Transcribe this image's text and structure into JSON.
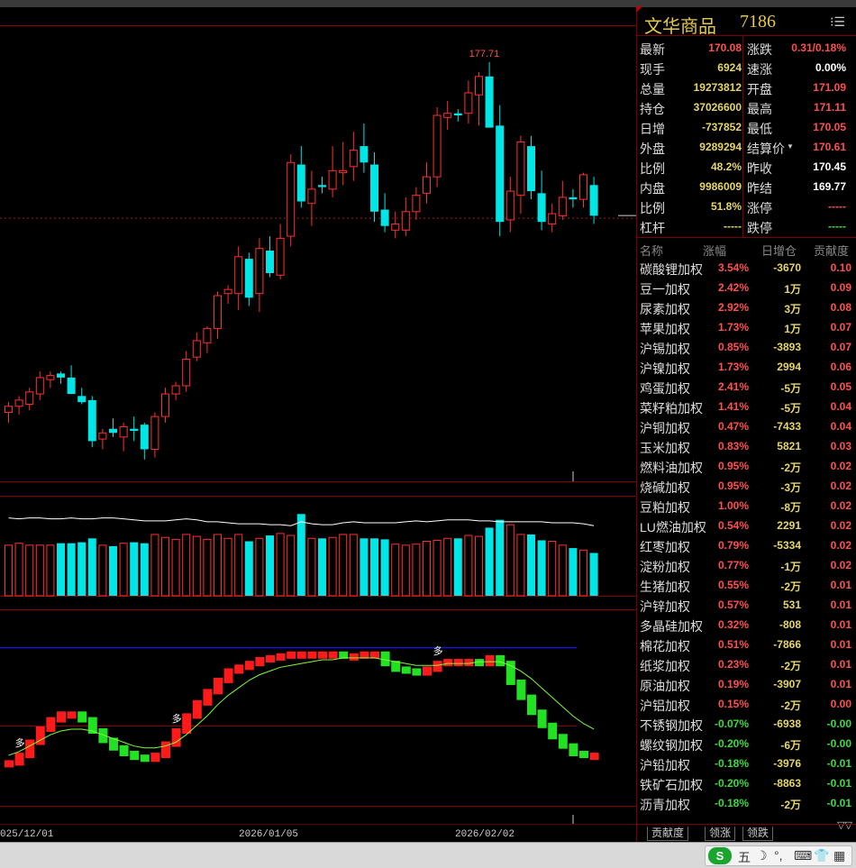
{
  "title": {
    "name": "文华商品",
    "code": "7186",
    "menu_icon": "menu-list-icon"
  },
  "quote": [
    {
      "label": "最新",
      "value": "170.08",
      "color": "#ff5050",
      "label2": "涨跌",
      "value2": "0.31/0.18%",
      "color2": "#ff5050"
    },
    {
      "label": "现手",
      "value": "6924",
      "color": "#e6d66a",
      "label2": "速涨",
      "value2": "0.00%",
      "color2": "#ffffff"
    },
    {
      "label": "总量",
      "value": "19273812",
      "color": "#e6d66a",
      "label2": "开盘",
      "value2": "171.09",
      "color2": "#ff5050"
    },
    {
      "label": "持仓",
      "value": "37026600",
      "color": "#e6d66a",
      "label2": "最高",
      "value2": "171.11",
      "color2": "#ff5050"
    },
    {
      "label": "日增",
      "value": "-737852",
      "color": "#e6d66a",
      "label2": "最低",
      "value2": "170.05",
      "color2": "#ff5050"
    },
    {
      "label": "外盘",
      "value": "9289294",
      "color": "#e6d66a",
      "label2": "结算价",
      "value2": "170.61",
      "color2": "#ff5050"
    },
    {
      "label": "比例",
      "value": "48.2%",
      "color": "#e6d66a",
      "label2": "昨收",
      "value2": "170.45",
      "color2": "#ffffff"
    },
    {
      "label": "内盘",
      "value": "9986009",
      "color": "#e6d66a",
      "label2": "昨结",
      "value2": "169.77",
      "color2": "#ffffff"
    },
    {
      "label": "比例",
      "value": "51.8%",
      "color": "#e6d66a",
      "label2": "涨停",
      "value2": "-----",
      "color2": "#ff5050"
    },
    {
      "label": "杠杆",
      "value": "-----",
      "color": "#e6d66a",
      "label2": "跌停",
      "value2": "-----",
      "color2": "#3ddc3d"
    }
  ],
  "contrib_header": {
    "name": "名称",
    "pct": "涨幅",
    "oi": "日增仓",
    "contrib": "贡献度"
  },
  "contrib": [
    {
      "name": "碳酸锂加权",
      "pct": "3.54%",
      "oi": "-3670",
      "c": "0.10",
      "up": true
    },
    {
      "name": "豆一加权",
      "pct": "2.42%",
      "oi": "1万",
      "c": "0.09",
      "up": true
    },
    {
      "name": "尿素加权",
      "pct": "2.92%",
      "oi": "3万",
      "c": "0.08",
      "up": true
    },
    {
      "name": "苹果加权",
      "pct": "1.73%",
      "oi": "1万",
      "c": "0.07",
      "up": true
    },
    {
      "name": "沪锡加权",
      "pct": "0.85%",
      "oi": "-3893",
      "c": "0.07",
      "up": true
    },
    {
      "name": "沪镍加权",
      "pct": "1.73%",
      "oi": "2994",
      "c": "0.06",
      "up": true
    },
    {
      "name": "鸡蛋加权",
      "pct": "2.41%",
      "oi": "-5万",
      "c": "0.05",
      "up": true
    },
    {
      "name": "菜籽粕加权",
      "pct": "1.41%",
      "oi": "-5万",
      "c": "0.04",
      "up": true
    },
    {
      "name": "沪铜加权",
      "pct": "0.47%",
      "oi": "-7433",
      "c": "0.04",
      "up": true
    },
    {
      "name": "玉米加权",
      "pct": "0.83%",
      "oi": "5821",
      "c": "0.03",
      "up": true
    },
    {
      "name": "燃料油加权",
      "pct": "0.95%",
      "oi": "-2万",
      "c": "0.02",
      "up": true
    },
    {
      "name": "烧碱加权",
      "pct": "0.95%",
      "oi": "-3万",
      "c": "0.02",
      "up": true
    },
    {
      "name": "豆粕加权",
      "pct": "1.00%",
      "oi": "-8万",
      "c": "0.02",
      "up": true
    },
    {
      "name": "LU燃油加权",
      "pct": "0.54%",
      "oi": "2291",
      "c": "0.02",
      "up": true
    },
    {
      "name": "红枣加权",
      "pct": "0.79%",
      "oi": "-5334",
      "c": "0.02",
      "up": true
    },
    {
      "name": "淀粉加权",
      "pct": "0.77%",
      "oi": "-1万",
      "c": "0.02",
      "up": true
    },
    {
      "name": "生猪加权",
      "pct": "0.55%",
      "oi": "-2万",
      "c": "0.01",
      "up": true
    },
    {
      "name": "沪锌加权",
      "pct": "0.57%",
      "oi": "531",
      "c": "0.01",
      "up": true
    },
    {
      "name": "多晶硅加权",
      "pct": "0.32%",
      "oi": "-808",
      "c": "0.01",
      "up": true
    },
    {
      "name": "棉花加权",
      "pct": "0.51%",
      "oi": "-7866",
      "c": "0.01",
      "up": true
    },
    {
      "name": "纸浆加权",
      "pct": "0.23%",
      "oi": "-2万",
      "c": "0.01",
      "up": true
    },
    {
      "name": "原油加权",
      "pct": "0.19%",
      "oi": "-3907",
      "c": "0.01",
      "up": true
    },
    {
      "name": "沪铝加权",
      "pct": "0.15%",
      "oi": "-2万",
      "c": "0.00",
      "up": true
    },
    {
      "name": "不锈钢加权",
      "pct": "-0.07%",
      "oi": "-6938",
      "c": "-0.00",
      "up": false
    },
    {
      "name": "螺纹钢加权",
      "pct": "-0.20%",
      "oi": "-6万",
      "c": "-0.00",
      "up": false
    },
    {
      "name": "沪铅加权",
      "pct": "-0.18%",
      "oi": "-3976",
      "c": "-0.01",
      "up": false
    },
    {
      "name": "铁矿石加权",
      "pct": "-0.20%",
      "oi": "-8863",
      "c": "-0.01",
      "up": false
    },
    {
      "name": "沥青加权",
      "pct": "-0.18%",
      "oi": "-2万",
      "c": "-0.01",
      "up": false
    }
  ],
  "tabs": [
    "贡献度",
    "领涨",
    "领跌"
  ],
  "x_axis": [
    "025/12/01",
    "2026/01/05",
    "2026/02/02"
  ],
  "peak_label": "177.71",
  "indicator_marker": "多",
  "colors": {
    "up": "#ff3030",
    "down": "#00e5e5",
    "panel_border": "#7a0000",
    "ma": "#ffffff",
    "ind_up": "#ff1a1a",
    "ind_down": "#22e022",
    "ind_line": "#7cfc3c",
    "ind_ref": "#1a1acc"
  },
  "ime": {
    "items": [
      "五",
      "☽",
      "°,",
      "⌨",
      "👕",
      "▦"
    ]
  },
  "chart_data": {
    "type": "candlestick",
    "candles": [
      [
        160.6,
        161.1,
        160.1,
        160.9
      ],
      [
        160.9,
        161.4,
        160.5,
        161.2
      ],
      [
        161.0,
        161.8,
        160.7,
        161.6
      ],
      [
        161.5,
        162.6,
        161.2,
        162.3
      ],
      [
        162.2,
        162.6,
        161.8,
        162.4
      ],
      [
        162.5,
        162.6,
        162.0,
        162.3
      ],
      [
        162.3,
        162.9,
        161.7,
        161.5
      ],
      [
        161.4,
        161.8,
        161.0,
        161.1
      ],
      [
        161.2,
        161.4,
        158.9,
        159.2
      ],
      [
        159.3,
        159.8,
        158.8,
        159.6
      ],
      [
        159.8,
        160.3,
        159.4,
        159.6
      ],
      [
        159.4,
        160.1,
        158.7,
        159.9
      ],
      [
        159.8,
        160.4,
        159.2,
        159.7
      ],
      [
        160.0,
        160.1,
        158.3,
        158.8
      ],
      [
        158.8,
        160.6,
        158.4,
        160.4
      ],
      [
        160.4,
        161.8,
        160.1,
        161.5
      ],
      [
        161.5,
        162.1,
        161.2,
        161.9
      ],
      [
        161.9,
        163.6,
        161.6,
        163.2
      ],
      [
        163.3,
        164.5,
        163.1,
        164.1
      ],
      [
        164.0,
        164.8,
        163.5,
        164.7
      ],
      [
        164.7,
        166.5,
        164.2,
        166.3
      ],
      [
        166.4,
        166.8,
        165.9,
        166.6
      ],
      [
        166.4,
        168.7,
        165.6,
        168.2
      ],
      [
        168.1,
        168.4,
        165.8,
        166.2
      ],
      [
        166.4,
        169.1,
        165.5,
        168.6
      ],
      [
        168.5,
        169.2,
        167.2,
        167.4
      ],
      [
        167.3,
        169.8,
        167.1,
        169.1
      ],
      [
        169.2,
        173.2,
        168.7,
        172.8
      ],
      [
        172.7,
        173.6,
        170.6,
        170.9
      ],
      [
        170.8,
        172.4,
        169.7,
        171.5
      ],
      [
        171.7,
        172.1,
        171.3,
        171.6
      ],
      [
        171.5,
        173.6,
        171.1,
        172.4
      ],
      [
        172.3,
        173.8,
        171.7,
        172.4
      ],
      [
        172.6,
        174.3,
        171.9,
        173.4
      ],
      [
        173.6,
        174.7,
        172.3,
        172.8
      ],
      [
        172.7,
        173.3,
        169.9,
        170.4
      ],
      [
        170.5,
        171.3,
        169.4,
        169.7
      ],
      [
        169.5,
        170.4,
        169.1,
        169.8
      ],
      [
        169.5,
        171.1,
        169.2,
        170.4
      ],
      [
        170.4,
        171.6,
        170.0,
        171.2
      ],
      [
        171.3,
        172.8,
        170.8,
        172.1
      ],
      [
        172.1,
        175.5,
        171.6,
        175.1
      ],
      [
        175.0,
        175.8,
        174.4,
        175.2
      ],
      [
        175.2,
        175.4,
        174.8,
        175.1
      ],
      [
        175.2,
        176.8,
        174.7,
        176.2
      ],
      [
        176.1,
        177.2,
        174.6,
        177.0
      ],
      [
        177.0,
        177.7,
        175.8,
        174.5
      ],
      [
        174.6,
        175.6,
        169.2,
        169.9
      ],
      [
        170.0,
        172.1,
        169.4,
        171.4
      ],
      [
        171.2,
        174.1,
        170.3,
        173.8
      ],
      [
        173.6,
        174.1,
        171.0,
        171.4
      ],
      [
        171.3,
        172.4,
        169.5,
        169.9
      ],
      [
        169.8,
        170.8,
        169.4,
        170.3
      ],
      [
        170.2,
        171.9,
        170.0,
        171.1
      ],
      [
        171.1,
        171.5,
        170.6,
        171.0
      ],
      [
        171.0,
        172.3,
        170.6,
        172.2
      ],
      [
        171.7,
        172.1,
        169.8,
        170.2
      ]
    ],
    "volume_ma": [
      80,
      79,
      80,
      80,
      79,
      79,
      80,
      79,
      79,
      80,
      80,
      79,
      78,
      77,
      77,
      77,
      78,
      79,
      78,
      76,
      76,
      75,
      74,
      74,
      74,
      73,
      73,
      72,
      76,
      74,
      73,
      73,
      75,
      76,
      75,
      75,
      75,
      75,
      76,
      77,
      76,
      77,
      78,
      78,
      78,
      77,
      77,
      76,
      76,
      76,
      76,
      76,
      75,
      75,
      75,
      74,
      72
    ],
    "volume": [
      52,
      54,
      52,
      52,
      52,
      54,
      54,
      55,
      59,
      52,
      51,
      54,
      55,
      54,
      63,
      60,
      58,
      63,
      61,
      58,
      63,
      59,
      63,
      56,
      59,
      62,
      64,
      62,
      84,
      59,
      59,
      60,
      63,
      63,
      59,
      59,
      58,
      53,
      52,
      53,
      56,
      57,
      59,
      59,
      62,
      61,
      70,
      78,
      73,
      63,
      63,
      57,
      56,
      52,
      49,
      47,
      44
    ],
    "indicator": [
      20,
      24,
      31,
      38,
      43,
      46,
      46,
      43,
      37,
      32,
      28,
      25,
      23,
      22,
      24,
      30,
      37,
      45,
      52,
      58,
      64,
      69,
      71,
      73,
      75,
      76,
      77,
      78,
      78,
      78,
      78,
      78,
      77,
      77,
      78,
      78,
      73,
      70,
      69,
      68,
      70,
      73,
      74,
      74,
      74,
      73,
      76,
      73,
      63,
      55,
      47,
      40,
      34,
      29,
      25,
      24,
      24
    ],
    "indicator_ma": [
      24,
      26,
      29,
      32,
      35,
      37,
      38,
      38,
      37,
      35,
      33,
      31,
      29,
      28,
      28,
      29,
      31,
      35,
      40,
      45,
      51,
      56,
      60,
      64,
      67,
      69,
      71,
      72,
      73,
      74,
      75,
      75,
      76,
      76,
      76,
      76,
      75,
      74,
      73,
      72,
      72,
      72,
      73,
      73,
      73,
      74,
      74,
      74,
      72,
      69,
      65,
      60,
      55,
      50,
      45,
      41,
      38
    ],
    "price_range": [
      157.5,
      179.5
    ],
    "last_price": 170.08,
    "x_ticks": [
      "025/12/01",
      "2026/01/05",
      "2026/02/02"
    ]
  }
}
